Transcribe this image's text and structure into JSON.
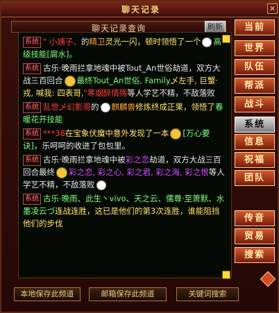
{
  "window": {
    "title": "聊天记录"
  },
  "header": {
    "subtitle": "聊天记录查询",
    "refresh_label": "刷新"
  },
  "side_menu": {
    "items": [
      {
        "label": "当前",
        "style": "red"
      },
      {
        "label": "世界",
        "style": "red"
      },
      {
        "label": "队伍",
        "style": "red"
      },
      {
        "label": "帮派",
        "style": "red"
      },
      {
        "label": "战斗",
        "style": "red"
      },
      {
        "label": "系统",
        "style": "gray"
      },
      {
        "label": "信息",
        "style": "red"
      },
      {
        "label": "祝福",
        "style": "red"
      },
      {
        "label": "团队",
        "style": "red"
      },
      {
        "label": "传音",
        "style": "red"
      },
      {
        "label": "贸易",
        "style": "red"
      },
      {
        "label": "搜索",
        "style": "red"
      }
    ]
  },
  "bottom_buttons": [
    {
      "label": "本地保存此频道"
    },
    {
      "label": "邮箱保存此频道"
    },
    {
      "label": "关键词搜索"
    }
  ],
  "chat": {
    "system_tag": "系统",
    "messages": [
      {
        "segments": [
          {
            "t": "\" 小姨子、",
            "c": "red"
          },
          {
            "t": "的",
            "c": "white"
          },
          {
            "t": "精卫",
            "c": "orange"
          },
          {
            "t": "灵光一闪，顿时领悟了一个",
            "c": "yellow"
          },
          {
            "t": "高级技能[腐水]。",
            "c": "green"
          }
        ]
      },
      {
        "segments": [
          {
            "t": "古乐·晚雨拦拿地魂中被Tout_An世俗劫道，双方大战三百回合",
            "c": "white"
          },
          {
            "t": "最终Tout_An世俗, Family",
            "c": "green"
          },
          {
            "t": "乄左手, 巨蟹·戎, 喊我: 四表哥,",
            "c": "yellow"
          },
          {
            "t": "\"寒烟醉情殇",
            "c": "red"
          },
          {
            "t": "等人学艺不精，不敌落败",
            "c": "white"
          }
        ]
      },
      {
        "segments": [
          {
            "t": "乱世乄幻影哥",
            "c": "red"
          },
          {
            "t": "的",
            "c": "white"
          },
          {
            "t": "麒麟兽",
            "c": "orange"
          },
          {
            "t": "修炼终成正果，领悟了",
            "c": "yellow"
          },
          {
            "t": "春暖花开技能",
            "c": "green"
          }
        ]
      },
      {
        "segments": [
          {
            "t": "***38",
            "c": "red"
          },
          {
            "t": "在宝象伏魔中意外发现了一本",
            "c": "yellow"
          },
          {
            "t": "[万心要诀]",
            "c": "green"
          },
          {
            "t": "，乐呵呵的收进了包包里。",
            "c": "white"
          }
        ]
      },
      {
        "segments": [
          {
            "t": "古乐·晚雨拦拿地魂中被",
            "c": "white"
          },
          {
            "t": "彩之恋",
            "c": "purple"
          },
          {
            "t": "劫道，双方大战三百回合",
            "c": "white"
          },
          {
            "t": "最终",
            "c": "white"
          },
          {
            "t": "彩之恋, 彩之心, 彩之君, 彩之海, 彩之恨",
            "c": "purple"
          },
          {
            "t": "等人学艺不精，不敌落败",
            "c": "white"
          }
        ]
      },
      {
        "segments": [
          {
            "t": "古乐·晚雨、此生丶vivo、天之云、儒尊·至萧默、水墨凌云づ",
            "c": "green"
          },
          {
            "t": "连战连胜，这已是他们的第3次连胜，谁能阻挡他们的步伐",
            "c": "yellow"
          }
        ]
      }
    ]
  }
}
